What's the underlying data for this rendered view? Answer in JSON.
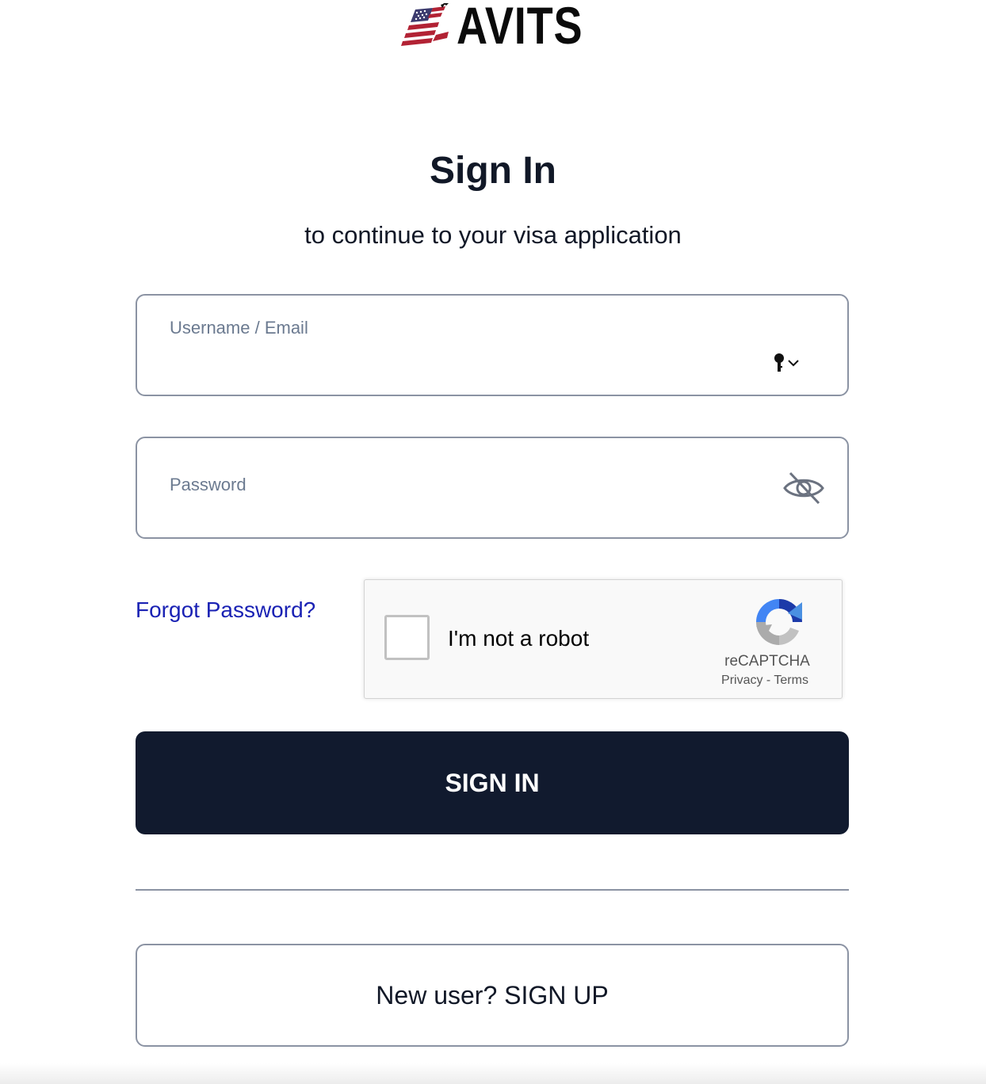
{
  "logo": {
    "text": "AVITS",
    "mark_icon": "american-flag-figure-logo",
    "flag_red": "#b22234",
    "flag_blue": "#3c3b6e"
  },
  "heading": {
    "title": "Sign In",
    "subtitle": "to continue to your visa application"
  },
  "form": {
    "username": {
      "placeholder": "Username / Email",
      "value": "",
      "autofill_icon": "password-key-icon"
    },
    "password": {
      "placeholder": "Password",
      "value": "",
      "toggle_icon": "eye-slash-icon"
    },
    "forgot_password_label": "Forgot Password?",
    "link_color": "#1a22b4"
  },
  "captcha": {
    "checkbox_label": "I'm not a robot",
    "checked": false,
    "brand": "reCAPTCHA",
    "privacy_label": "Privacy",
    "separator": "-",
    "terms_label": "Terms"
  },
  "actions": {
    "signin_label": "SIGN IN",
    "signin_color": "#111a2e",
    "signup_label": "New user? SIGN UP"
  }
}
